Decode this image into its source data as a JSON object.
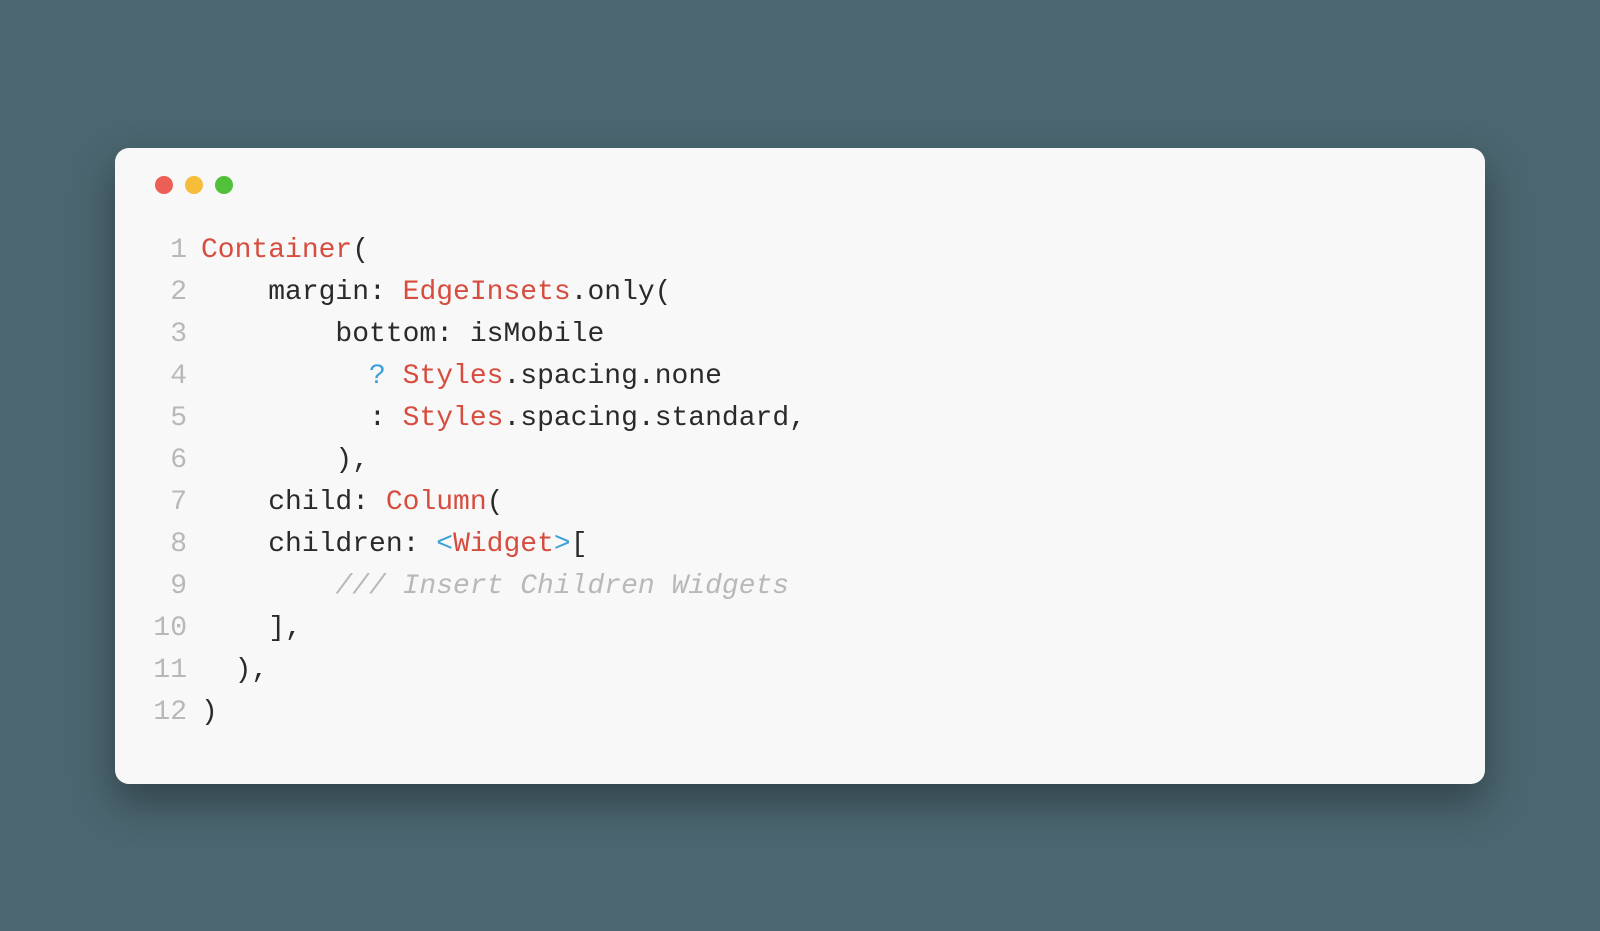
{
  "window": {
    "traffic_lights": [
      "red",
      "yellow",
      "green"
    ]
  },
  "code": {
    "lines": [
      {
        "n": "1",
        "tokens": [
          {
            "cls": "tok-class",
            "t": "Container"
          },
          {
            "cls": "tok-default",
            "t": "("
          }
        ]
      },
      {
        "n": "2",
        "tokens": [
          {
            "cls": "tok-default",
            "t": "    margin: "
          },
          {
            "cls": "tok-class",
            "t": "EdgeInsets"
          },
          {
            "cls": "tok-default",
            "t": ".only("
          }
        ]
      },
      {
        "n": "3",
        "tokens": [
          {
            "cls": "tok-default",
            "t": "        bottom: isMobile"
          }
        ]
      },
      {
        "n": "4",
        "tokens": [
          {
            "cls": "tok-default",
            "t": "          "
          },
          {
            "cls": "tok-op",
            "t": "?"
          },
          {
            "cls": "tok-default",
            "t": " "
          },
          {
            "cls": "tok-class",
            "t": "Styles"
          },
          {
            "cls": "tok-default",
            "t": ".spacing.none"
          }
        ]
      },
      {
        "n": "5",
        "tokens": [
          {
            "cls": "tok-default",
            "t": "          : "
          },
          {
            "cls": "tok-class",
            "t": "Styles"
          },
          {
            "cls": "tok-default",
            "t": ".spacing.standard,"
          }
        ]
      },
      {
        "n": "6",
        "tokens": [
          {
            "cls": "tok-default",
            "t": "        ),"
          }
        ]
      },
      {
        "n": "7",
        "tokens": [
          {
            "cls": "tok-default",
            "t": "    child: "
          },
          {
            "cls": "tok-class",
            "t": "Column"
          },
          {
            "cls": "tok-default",
            "t": "("
          }
        ]
      },
      {
        "n": "8",
        "tokens": [
          {
            "cls": "tok-default",
            "t": "    children: "
          },
          {
            "cls": "tok-angle",
            "t": "<"
          },
          {
            "cls": "tok-class",
            "t": "Widget"
          },
          {
            "cls": "tok-angle",
            "t": ">"
          },
          {
            "cls": "tok-default",
            "t": "["
          }
        ]
      },
      {
        "n": "9",
        "tokens": [
          {
            "cls": "tok-default",
            "t": "        "
          },
          {
            "cls": "tok-comment",
            "t": "/// Insert Children Widgets"
          }
        ]
      },
      {
        "n": "10",
        "tokens": [
          {
            "cls": "tok-default",
            "t": "    ],"
          }
        ]
      },
      {
        "n": "11",
        "tokens": [
          {
            "cls": "tok-default",
            "t": "  ),"
          }
        ]
      },
      {
        "n": "12",
        "tokens": [
          {
            "cls": "tok-default",
            "t": ")"
          }
        ]
      }
    ]
  }
}
